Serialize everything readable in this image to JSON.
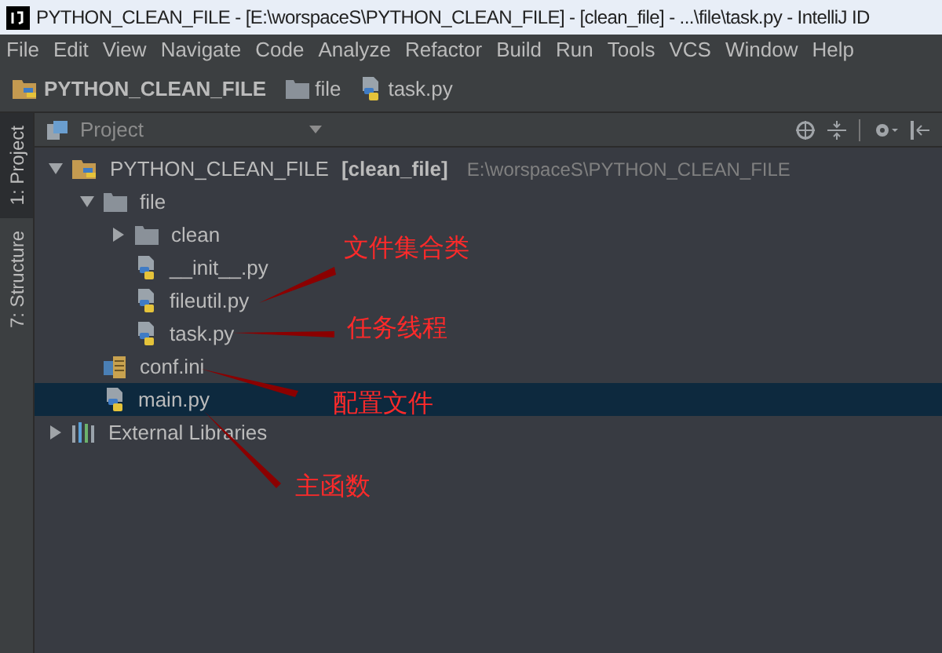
{
  "window": {
    "title": "PYTHON_CLEAN_FILE - [E:\\worspaceS\\PYTHON_CLEAN_FILE] - [clean_file] - ...\\file\\task.py - IntelliJ ID"
  },
  "menu": [
    "File",
    "Edit",
    "View",
    "Navigate",
    "Code",
    "Analyze",
    "Refactor",
    "Build",
    "Run",
    "Tools",
    "VCS",
    "Window",
    "Help"
  ],
  "breadcrumb": [
    {
      "label": "PYTHON_CLEAN_FILE",
      "kind": "project"
    },
    {
      "label": "file",
      "kind": "folder"
    },
    {
      "label": "task.py",
      "kind": "python"
    }
  ],
  "side_tabs": [
    {
      "label": "1: Project",
      "selected": true
    },
    {
      "label": "7: Structure",
      "selected": false
    }
  ],
  "panel": {
    "title": "Project"
  },
  "tree": [
    {
      "kind": "project",
      "label": "PYTHON_CLEAN_FILE",
      "module": "[clean_file]",
      "path": "E:\\worspaceS\\PYTHON_CLEAN_FILE",
      "expanded": true,
      "selected": false,
      "children": [
        {
          "kind": "folder",
          "label": "file",
          "expanded": true,
          "selected": false,
          "children": [
            {
              "kind": "folder",
              "label": "clean",
              "expanded": false,
              "selected": false
            },
            {
              "kind": "python",
              "label": "__init__.py",
              "selected": false
            },
            {
              "kind": "python",
              "label": "fileutil.py",
              "selected": false
            },
            {
              "kind": "python",
              "label": "task.py",
              "selected": false
            }
          ]
        },
        {
          "kind": "ini",
          "label": "conf.ini",
          "selected": false
        },
        {
          "kind": "python",
          "label": "main.py",
          "selected": true
        }
      ]
    },
    {
      "kind": "library",
      "label": "External Libraries",
      "expanded": false,
      "selected": false
    }
  ],
  "annotations": [
    "文件集合类",
    "任务线程",
    "配置文件",
    "主函数"
  ]
}
